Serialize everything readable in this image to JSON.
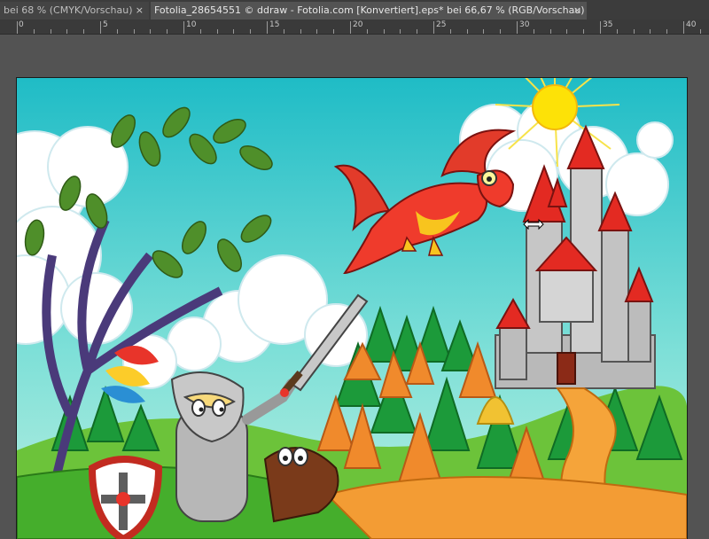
{
  "tabs": [
    {
      "label": "bei 68 % (CMYK/Vorschau)",
      "close": "×",
      "active": false
    },
    {
      "label": "Fotolia_28654551 © ddraw - Fotolia.com [Konvertiert].eps* bei 66,67 % (RGB/Vorschau)",
      "close": "×",
      "active": true
    }
  ],
  "ruler": {
    "labels": [
      "0",
      "5",
      "10",
      "15",
      "20",
      "25",
      "30",
      "35",
      "40"
    ]
  },
  "artwork": {
    "subject": "cartoon illustration",
    "elements": [
      "sun-icon",
      "dragon",
      "castle",
      "knight",
      "tree",
      "forest",
      "clouds"
    ]
  },
  "colors": {
    "workspace": "#535353",
    "sky": "#22c3c9",
    "tab_active": "#535353",
    "tab_inactive": "#444444"
  },
  "cursor": {
    "icon": "resize-horizontal-cursor-icon"
  }
}
